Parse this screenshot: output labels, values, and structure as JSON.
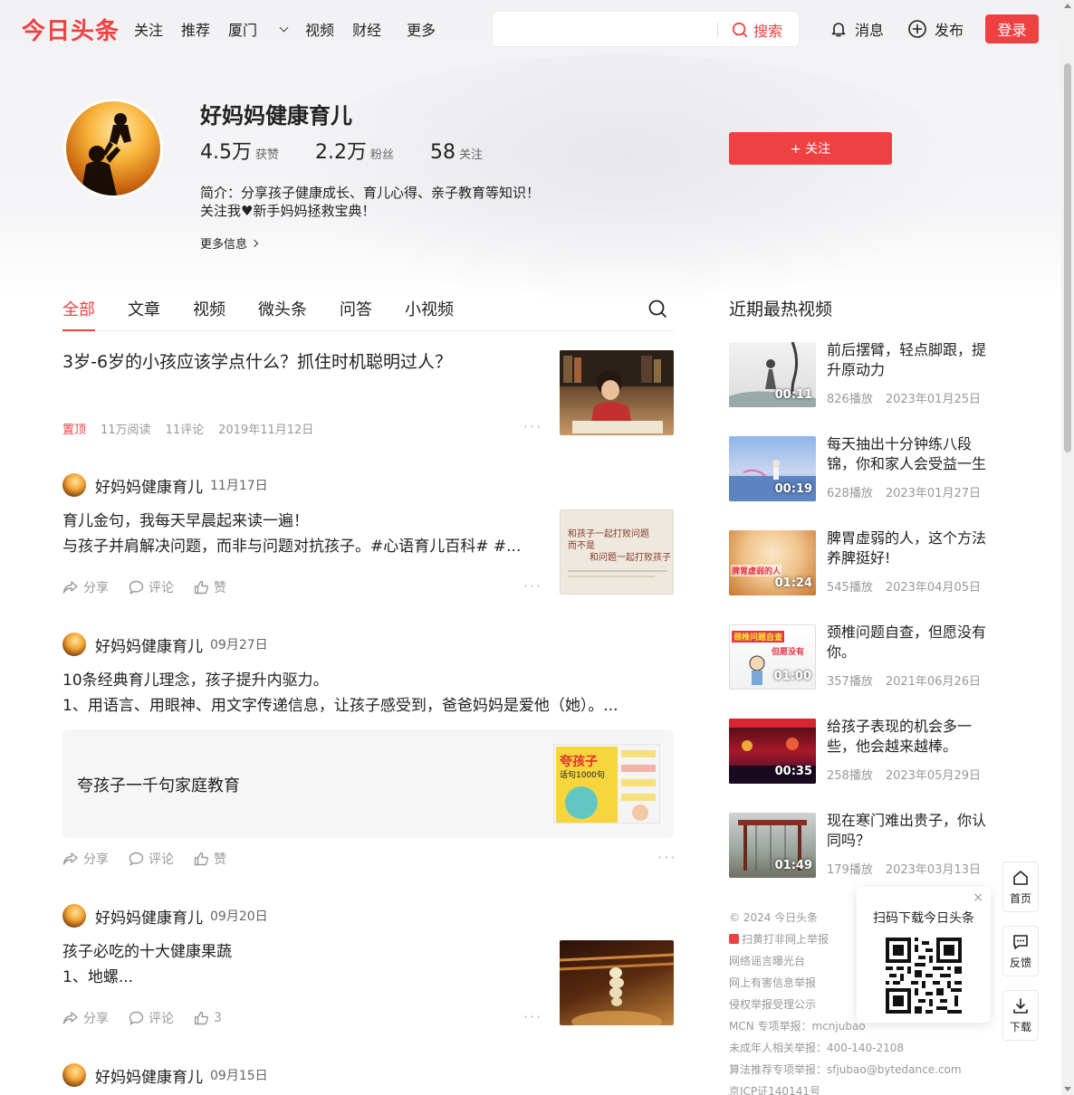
{
  "header": {
    "logo": "今日头条",
    "nav": [
      "关注",
      "推荐",
      "厦门",
      "视频",
      "财经",
      "更多"
    ],
    "search": {
      "placeholder": "",
      "button": "搜索"
    },
    "messages": "消息",
    "publish": "发布",
    "login": "登录"
  },
  "profile": {
    "name": "好妈妈健康育儿",
    "stats": [
      {
        "num": "4.5万",
        "label": "获赞"
      },
      {
        "num": "2.2万",
        "label": "粉丝"
      },
      {
        "num": "58",
        "label": "关注"
      }
    ],
    "follow": "+ 关注",
    "bio_line1": "简介：分享孩子健康成长、育儿心得、亲子教育等知识！",
    "bio_line2": "关注我♥新手妈妈拯救宝典！",
    "more_info": "更多信息"
  },
  "tabs": [
    "全部",
    "文章",
    "视频",
    "微头条",
    "问答",
    "小视频"
  ],
  "feed": {
    "pinned": {
      "title": "3岁-6岁的小孩应该学点什么？抓住时机聪明过人？",
      "pin": "置顶",
      "reads": "11万阅读",
      "comments": "11评论",
      "date": "2019年11月12日"
    },
    "posts": [
      {
        "author": "好妈妈健康育儿",
        "date": "11月17日",
        "line1": "育儿金句，我每天早晨起来读一遍！",
        "line2": "与孩子并肩解决问题，而非与问题对抗孩子。#心语育儿百科# #...",
        "thumb_text1": "和孩子一起打败问题",
        "thumb_text2": "而不是",
        "thumb_text3": "和问题一起打败孩子",
        "share": "分享",
        "comment": "评论",
        "like": "赞"
      },
      {
        "author": "好妈妈健康育儿",
        "date": "09月27日",
        "line1": "10条经典育儿理念，孩子提升内驱力。",
        "line2": "1、用语言、用眼神、用文字传递信息，让孩子感受到，爸爸妈妈是爱他（她）。...",
        "embed_title": "夸孩子一千句家庭教育",
        "book_title": "夸孩子",
        "book_sub": "话句1000句",
        "share": "分享",
        "comment": "评论",
        "like": "赞"
      },
      {
        "author": "好妈妈健康育儿",
        "date": "09月20日",
        "line1": "孩子必吃的十大健康果蔬",
        "line2": "1、地螺...",
        "share": "分享",
        "comment": "评论",
        "like": "3"
      },
      {
        "author": "好妈妈健康育儿",
        "date": "09月15日"
      }
    ]
  },
  "sidebar": {
    "title": "近期最热视频",
    "videos": [
      {
        "title": "前后摆臂，轻点脚跟，提升原动力",
        "duration": "00:11",
        "plays": "826播放",
        "date": "2023年01月25日"
      },
      {
        "title": "每天抽出十分钟练八段锦，你和家人会受益一生",
        "duration": "00:19",
        "plays": "628播放",
        "date": "2023年01月27日"
      },
      {
        "title": "脾胃虚弱的人，这个方法养脾挺好!",
        "duration": "01:24",
        "plays": "545播放",
        "date": "2023年04月05日",
        "overlay": "脾胃虚弱的人"
      },
      {
        "title": "颈椎问题自查，但愿没有你。",
        "duration": "01:00",
        "plays": "357播放",
        "date": "2021年06月26日",
        "overlay": "颈椎问题自查",
        "overlay2": "但愿没有"
      },
      {
        "title": "给孩子表现的机会多一些，他会越来越棒。",
        "duration": "00:35",
        "plays": "258播放",
        "date": "2023年05月29日"
      },
      {
        "title": "现在寒门难出贵子，你认同吗？",
        "duration": "01:49",
        "plays": "179播放",
        "date": "2023年03月13日"
      }
    ],
    "footer": [
      "© 2024 今日头条",
      "扫黄打非网上举报",
      "网络谣言曝光台",
      "网上有害信息举报",
      "侵权举报受理公示",
      "MCN 专项举报：mcnjubao",
      "未成年人相关举报：400-140-2108",
      "算法推荐专项举报：sfjubao@bytedance.com",
      "京ICP证140141号"
    ]
  },
  "qr": {
    "title": "扫码下载今日头条",
    "close": "×"
  },
  "float": {
    "home": "首页",
    "feedback": "反馈",
    "download": "下载"
  },
  "colors": {
    "brand": "#f04142",
    "muted": "#999999"
  }
}
